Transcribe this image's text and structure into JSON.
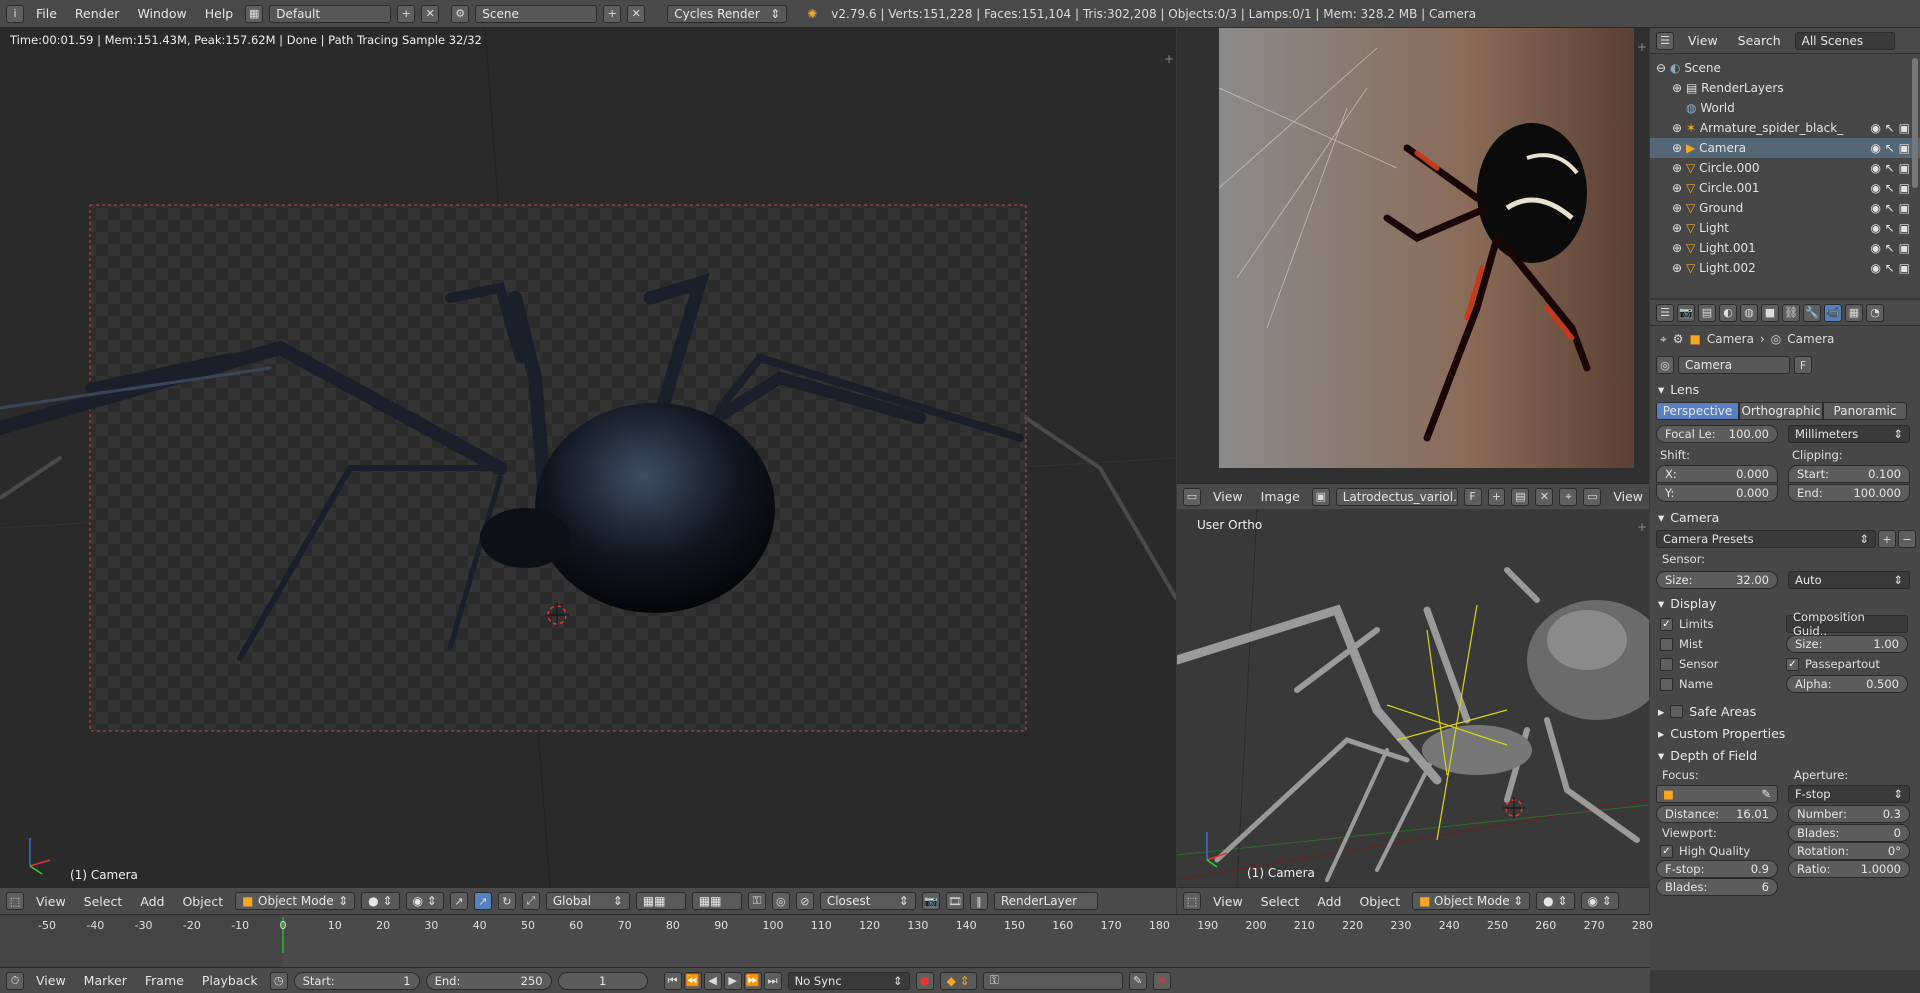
{
  "topbar": {
    "menus": [
      "File",
      "Render",
      "Window",
      "Help"
    ],
    "screen_layout": "Default",
    "scene": "Scene",
    "engine": "Cycles Render",
    "stats": "v2.79.6 | Verts:151,228 | Faces:151,104 | Tris:302,208 | Objects:0/3 | Lamps:0/1 | Mem: 328.2 MB | Camera"
  },
  "main_viewport": {
    "render_info": "Time:00:01.59 | Mem:151.43M, Peak:157.62M | Done | Path Tracing Sample 32/32",
    "object_label": "(1) Camera",
    "header": {
      "menus": [
        "View",
        "Select",
        "Add",
        "Object"
      ],
      "mode": "Object Mode",
      "orientation": "Global",
      "snap": "Closest",
      "render_layer": "RenderLayer"
    }
  },
  "image_editor": {
    "header": {
      "menus": [
        "View",
        "Image"
      ],
      "image_name": "Latrodectus_variol..",
      "fake_user": "F",
      "view_label": "View"
    }
  },
  "ortho_viewport": {
    "view_label": "User Ortho",
    "object_label": "(1) Camera",
    "header": {
      "menus": [
        "View",
        "Select",
        "Add",
        "Object"
      ],
      "mode": "Object Mode"
    }
  },
  "outliner": {
    "header": {
      "view": "View",
      "search": "Search",
      "filter": "All Scenes"
    },
    "items": [
      "Scene",
      "RenderLayers",
      "World",
      "Armature_spider_black_",
      "Camera",
      "Circle.000",
      "Circle.001",
      "Ground",
      "Light",
      "Light.001",
      "Light.002"
    ]
  },
  "properties": {
    "breadcrumb": [
      "Camera",
      "Camera"
    ],
    "datablock": "Camera",
    "datablock_flag": "F",
    "lens": {
      "title": "Lens",
      "tabs": [
        "Perspective",
        "Orthographic",
        "Panoramic"
      ],
      "focal_label": "Focal Le:",
      "focal_value": "100.00",
      "unit": "Millimeters",
      "shift_label": "Shift:",
      "shift_x_label": "X:",
      "shift_x": "0.000",
      "shift_y_label": "Y:",
      "shift_y": "0.000",
      "clip_label": "Clipping:",
      "clip_start_label": "Start:",
      "clip_start": "0.100",
      "clip_end_label": "End:",
      "clip_end": "100.000"
    },
    "camera": {
      "title": "Camera",
      "presets": "Camera Presets",
      "sensor_label": "Sensor:",
      "size_label": "Size:",
      "size_value": "32.00",
      "fit": "Auto"
    },
    "display": {
      "title": "Display",
      "limits": "Limits",
      "mist": "Mist",
      "sensor": "Sensor",
      "name": "Name",
      "composition": "Composition Guid..",
      "size_label": "Size:",
      "size_value": "1.00",
      "passepartout": "Passepartout",
      "alpha_label": "Alpha:",
      "alpha_value": "0.500"
    },
    "safe_areas": "Safe Areas",
    "custom_properties": "Custom Properties",
    "dof": {
      "title": "Depth of Field",
      "focus_label": "Focus:",
      "aperture_label": "Aperture:",
      "distance_label": "Distance:",
      "distance_value": "16.01",
      "aperture_type": "F-stop",
      "number_label": "Number:",
      "number_value": "0.3",
      "viewport_label": "Viewport:",
      "high_quality": "High Quality",
      "blades_label": "Blades:",
      "blades_value": "0",
      "rotation_label": "Rotation:",
      "rotation_value": "0°",
      "ratio_label": "Ratio:",
      "ratio_value": "1.0000",
      "fstop_label": "F-stop:",
      "fstop_value": "0.9",
      "vblades_label": "Blades:",
      "vblades_value": "6"
    }
  },
  "timeline": {
    "ticks": [
      "-50",
      "-40",
      "-30",
      "-20",
      "-10",
      "0",
      "10",
      "20",
      "30",
      "40",
      "50",
      "60",
      "70",
      "80",
      "90",
      "100",
      "110",
      "120",
      "130",
      "140",
      "150",
      "160",
      "170",
      "180",
      "190",
      "200",
      "210",
      "220",
      "230",
      "240",
      "250",
      "260",
      "270",
      "280"
    ],
    "menus": [
      "View",
      "Marker",
      "Frame",
      "Playback"
    ],
    "start_label": "Start:",
    "start": "1",
    "end_label": "End:",
    "end": "250",
    "current": "1",
    "sync": "No Sync"
  },
  "colors": {
    "accent_blue": "#5680c2",
    "selected_orange": "#f5a623",
    "frame_marker": "#2f9e2f"
  }
}
